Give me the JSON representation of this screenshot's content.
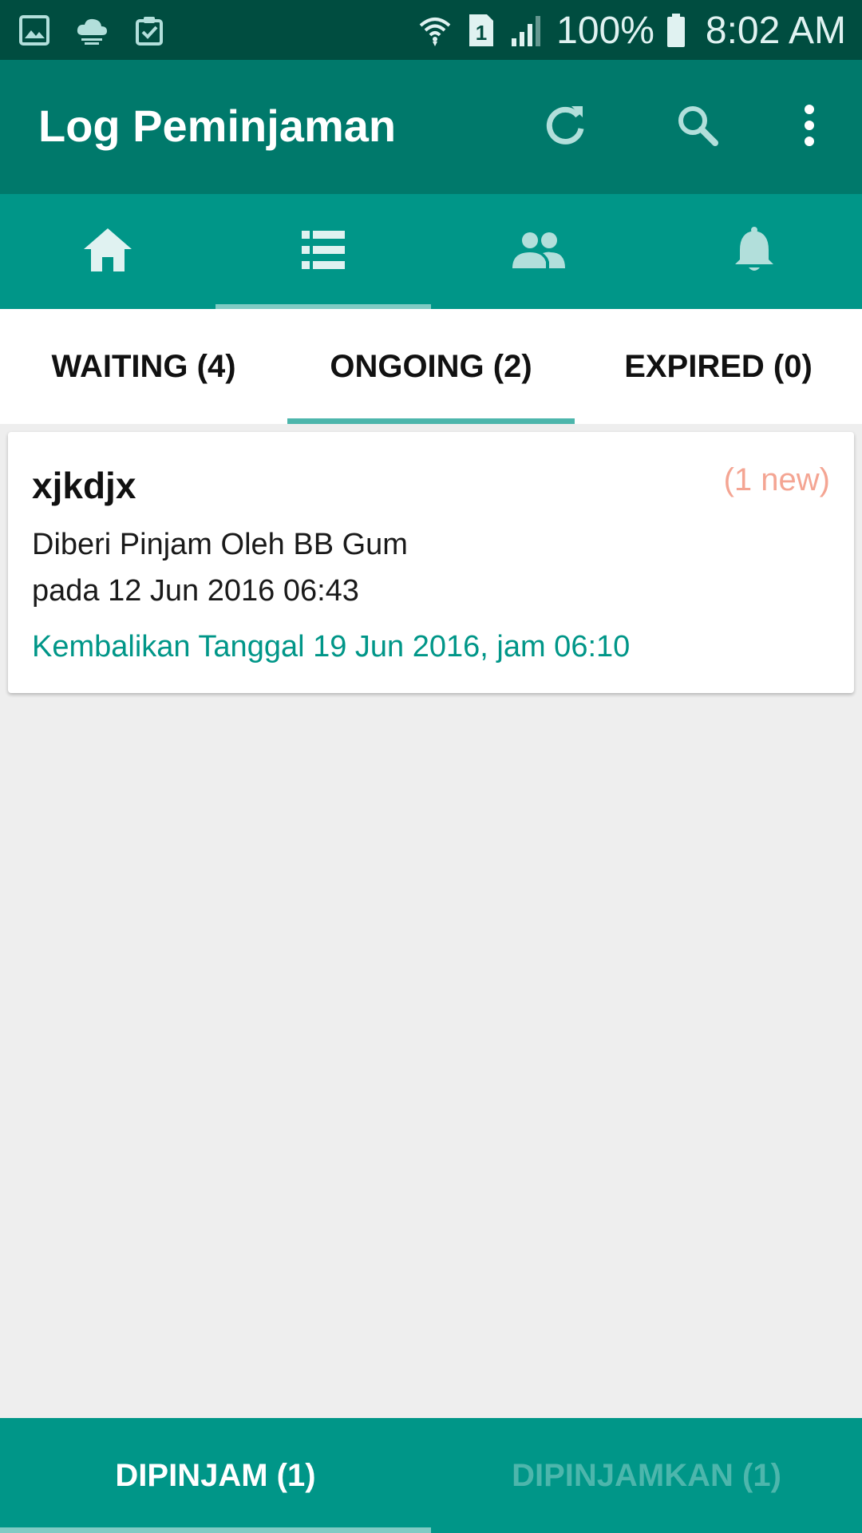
{
  "status_bar": {
    "icons_left": [
      "gallery-icon",
      "cloud-icon",
      "clipboard-check-icon"
    ],
    "icons_right": [
      "wifi-icon",
      "sim-1-icon",
      "signal-icon"
    ],
    "battery_percent": "100%",
    "time": "8:02 AM"
  },
  "app_bar": {
    "title": "Log Peminjaman",
    "actions": [
      "refresh-icon",
      "search-icon",
      "overflow-menu-icon"
    ]
  },
  "icon_tabs": {
    "items": [
      "home-icon",
      "list-icon",
      "people-icon",
      "bell-icon"
    ],
    "selected_index": 1
  },
  "sub_tabs": {
    "items": [
      {
        "label": "WAITING (4)"
      },
      {
        "label": "ONGOING (2)"
      },
      {
        "label": "EXPIRED (0)"
      }
    ],
    "selected_index": 1
  },
  "card": {
    "title": "xjkdjx",
    "badge": "(1 new)",
    "line1": "Diberi Pinjam Oleh BB Gum",
    "line2": "pada 12 Jun 2016 06:43",
    "return_text": "Kembalikan Tanggal 19 Jun 2016, jam 06:10"
  },
  "bottom_tabs": {
    "items": [
      {
        "label": "DIPINJAM (1)"
      },
      {
        "label": "DIPINJAMKAN (1)"
      }
    ],
    "selected_index": 0
  },
  "colors": {
    "status_bar": "#004d40",
    "app_bar": "#00796b",
    "tab_bar": "#009688",
    "indicator": "#80cbc4",
    "accent_text": "#009688",
    "badge_text": "#f4a593"
  }
}
